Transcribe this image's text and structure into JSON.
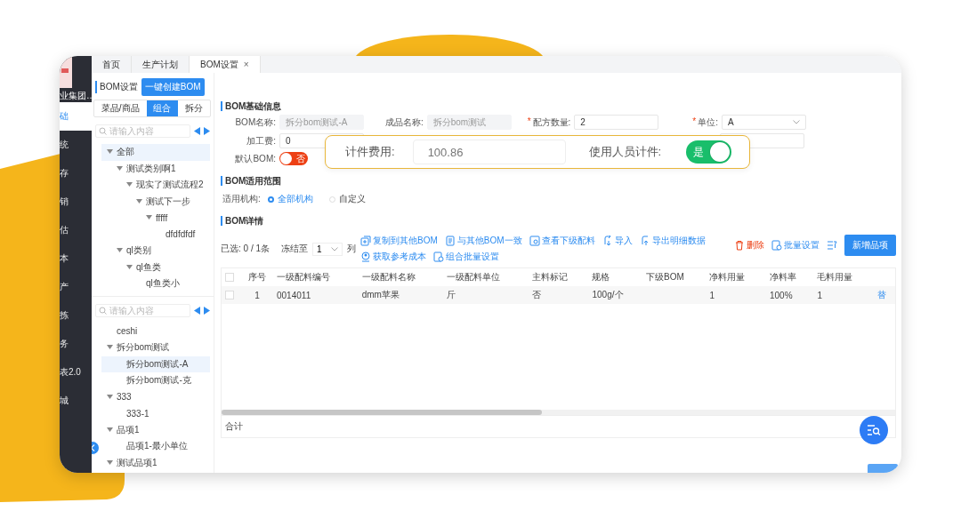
{
  "sidebar": {
    "logo_text": "业集团…",
    "items": [
      {
        "label": "础",
        "selected": true
      },
      {
        "label": "统",
        "selected": false
      },
      {
        "label": "存",
        "selected": false
      },
      {
        "label": "销",
        "selected": false
      },
      {
        "label": "估",
        "selected": false
      },
      {
        "label": "本",
        "selected": false
      },
      {
        "label": "产",
        "selected": false
      },
      {
        "label": "拣",
        "selected": false
      },
      {
        "label": "务",
        "selected": false
      },
      {
        "label": "表2.0",
        "selected": false
      },
      {
        "label": "城",
        "selected": false
      }
    ]
  },
  "tabs": [
    {
      "label": "首页",
      "selected": false
    },
    {
      "label": "生产计划",
      "selected": false
    },
    {
      "label": "BOM设置",
      "selected": true,
      "close": "×"
    }
  ],
  "left_panel": {
    "title": "BOM设置",
    "create_button": "一键创建BOM",
    "segments": [
      {
        "label": "菜品/商品",
        "selected": false
      },
      {
        "label": "组合",
        "selected": true
      },
      {
        "label": "拆分",
        "selected": false
      }
    ],
    "trees": [
      {
        "search_placeholder": "请输入内容",
        "nodes": [
          {
            "label": "全部",
            "expanded": true,
            "selected": true,
            "children": [
              {
                "label": "测试类别啊1",
                "expanded": true,
                "selected": false,
                "children": [
                  {
                    "label": "现实了测试流程2",
                    "expanded": true,
                    "selected": false,
                    "children": [
                      {
                        "label": "测试下一步",
                        "expanded": true,
                        "selected": false,
                        "children": [
                          {
                            "label": "fffff",
                            "expanded": true,
                            "selected": false,
                            "children": [
                              {
                                "label": "dfdfdfdf",
                                "selected": false
                              }
                            ]
                          }
                        ]
                      }
                    ]
                  }
                ]
              },
              {
                "label": "ql类别",
                "expanded": true,
                "selected": false,
                "children": [
                  {
                    "label": "ql鱼类",
                    "expanded": true,
                    "selected": false,
                    "children": [
                      {
                        "label": "ql鱼类小",
                        "selected": false
                      }
                    ]
                  }
                ]
              }
            ]
          }
        ]
      },
      {
        "search_placeholder": "请输入内容",
        "nodes": [
          {
            "label": "ceshi",
            "selected": false
          },
          {
            "label": "拆分bom测试",
            "expanded": true,
            "selected": false,
            "children": [
              {
                "label": "拆分bom测试-A",
                "selected": true
              },
              {
                "label": "拆分bom测试-克",
                "selected": false
              }
            ]
          },
          {
            "label": "333",
            "expanded": true,
            "selected": false,
            "children": [
              {
                "label": "333-1",
                "selected": false
              }
            ]
          },
          {
            "label": "品项1",
            "expanded": true,
            "selected": false,
            "children": [
              {
                "label": "品项1-最小单位",
                "selected": false
              }
            ]
          },
          {
            "label": "测试品项1",
            "expanded": true,
            "selected": false
          }
        ]
      }
    ]
  },
  "basic_info": {
    "title": "BOM基础信息",
    "rows": [
      [
        {
          "kind": "input",
          "label": "BOM名称:",
          "value": "拆分bom测试-A",
          "disabled": true
        },
        {
          "kind": "input",
          "label": "成品名称:",
          "value": "拆分bom测试",
          "disabled": true
        },
        {
          "kind": "input",
          "required_mark": "*",
          "label": "配方数量:",
          "value": "2",
          "disabled": false
        },
        {
          "kind": "select",
          "required_mark": "*",
          "label": "单位:",
          "value": "A",
          "disabled": false
        }
      ],
      [
        {
          "kind": "input",
          "label": "加工费:",
          "value": "0",
          "disabled": false
        },
        {
          "kind": "input"
        }
      ],
      [
        {
          "kind": "toggle",
          "label": "默认BOM:",
          "on": false,
          "text": "否"
        }
      ]
    ]
  },
  "highlight": {
    "cost_label": "计件费用:",
    "cost_value": "100.86",
    "toggle_label": "使用人员计件:",
    "toggle_on": true,
    "toggle_text": "是"
  },
  "scope": {
    "title": "BOM适用范围",
    "label": "适用机构:",
    "options": [
      {
        "label": "全部机构",
        "selected": true
      },
      {
        "label": "自定义",
        "selected": false
      }
    ]
  },
  "details": {
    "title": "BOM详情",
    "selection": "已选: 0 / 1条",
    "freeze_label": "冻结至",
    "freeze_value": "1",
    "freeze_unit": "列",
    "actions": [
      {
        "kind": "copy",
        "label": "复制到其他BOM"
      },
      {
        "kind": "doc",
        "label": "与其他BOM一致"
      },
      {
        "kind": "view",
        "label": "查看下级配料"
      },
      {
        "kind": "import",
        "label": "导入"
      },
      {
        "kind": "export",
        "label": "导出明细数据"
      },
      {
        "kind": "cost",
        "label": "获取参考成本"
      },
      {
        "kind": "batch",
        "label": "组合批量设置"
      }
    ],
    "right_actions": [
      {
        "kind": "delete",
        "label": "删除"
      },
      {
        "kind": "batch",
        "label": "批量设置"
      }
    ],
    "add_button": "新增品项",
    "table": {
      "select_all": false,
      "columns": [
        "序号",
        "一级配料编号",
        "一级配料名称",
        "一级配料单位",
        "主料标记",
        "规格",
        "下级BOM",
        "净料用量",
        "净料率",
        "毛料用量"
      ],
      "rows": [
        {
          "selected": false,
          "cells": [
            "1",
            "0014011",
            "dmm苹果",
            "斤",
            "否",
            "100g/个",
            null,
            "1",
            "100%",
            "1"
          ],
          "link": "替"
        }
      ]
    },
    "footer": "合计"
  }
}
